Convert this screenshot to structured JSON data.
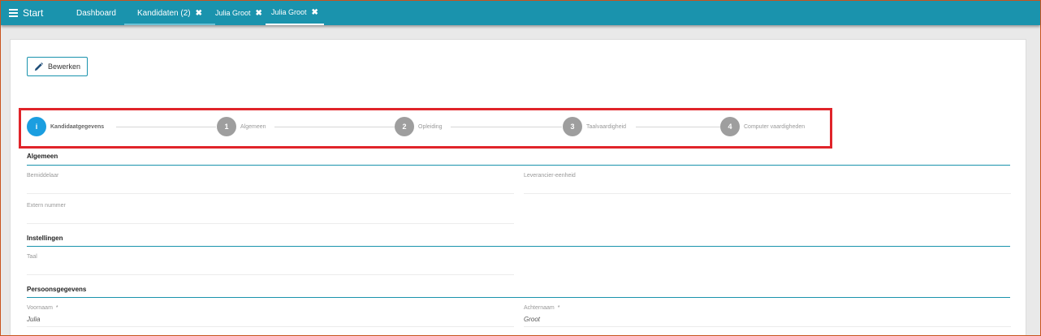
{
  "topbar": {
    "menu_label": "Start",
    "tabs": [
      {
        "label": "Dashboard",
        "closable": false
      },
      {
        "label": "Kandidaten (2)",
        "closable": true
      },
      {
        "label": "Julia Groot",
        "closable": true
      },
      {
        "label": "Julia Groot",
        "closable": true
      }
    ],
    "close_glyph": "✖"
  },
  "toolbar": {
    "edit_label": "Bewerken",
    "edit_icon": "pencil-icon"
  },
  "steps": [
    {
      "badge": "i",
      "label": "Kandidaatgegevens",
      "active": true
    },
    {
      "badge": "1",
      "label": "Algemeen",
      "active": false
    },
    {
      "badge": "2",
      "label": "Opleiding",
      "active": false
    },
    {
      "badge": "3",
      "label": "Taalvaardigheid",
      "active": false
    },
    {
      "badge": "4",
      "label": "Computer vaardigheden",
      "active": false
    }
  ],
  "sections": {
    "algemeen": {
      "title": "Algemeen",
      "bemiddelaar_label": "Bemiddelaar",
      "leverancier_label": "Leverancier-eenheid",
      "extern_label": "Extern nummer"
    },
    "instellingen": {
      "title": "Instellingen",
      "taal_label": "Taal"
    },
    "persoon": {
      "title": "Persoonsgegevens",
      "voornaam_label": "Voornaam",
      "voornaam_value": "Julia",
      "achternaam_label": "Achternaam",
      "achternaam_value": "Groot",
      "required_mark": "*"
    }
  },
  "colors": {
    "topbar": "#1a93ad",
    "active_step": "#1b9ee0",
    "inactive_step": "#9e9e9e",
    "highlight": "#e0242a"
  }
}
